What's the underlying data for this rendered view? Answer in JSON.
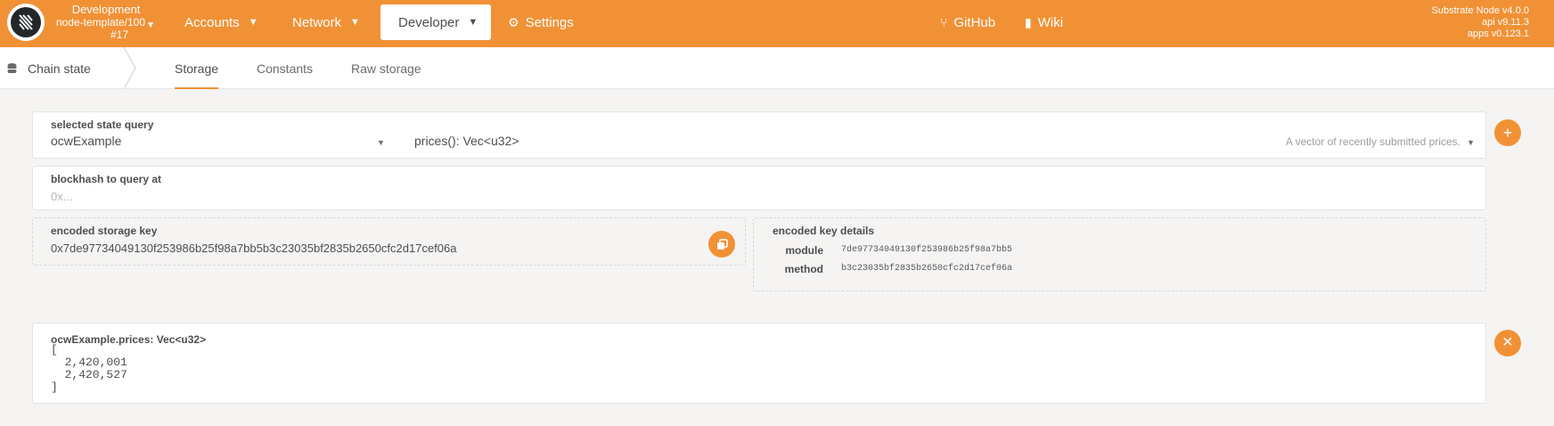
{
  "topbar": {
    "chain_name": "Development",
    "node": "node-template/100",
    "block": "#17",
    "menu": [
      {
        "label": "Accounts"
      },
      {
        "label": "Network"
      },
      {
        "label": "Developer"
      },
      {
        "label": "Settings"
      }
    ],
    "links": [
      {
        "label": "GitHub"
      },
      {
        "label": "Wiki"
      }
    ],
    "version": {
      "node": "Substrate Node v4.0.0",
      "api": "api v9.11.3",
      "apps": "apps v0.123.1"
    }
  },
  "subnav": {
    "section": "Chain state",
    "tabs": [
      "Storage",
      "Constants",
      "Raw storage"
    ]
  },
  "query": {
    "selected_label": "selected state query",
    "module_value": "ocwExample",
    "method_value": "prices(): Vec<u32>",
    "method_hint": "A vector of recently submitted prices."
  },
  "blockhash": {
    "label": "blockhash to query at",
    "placeholder": "0x..."
  },
  "encoded_key": {
    "label": "encoded storage key",
    "value": "0x7de97734049130f253986b25f98a7bb5b3c23035bf2835b2650cfc2d17cef06a"
  },
  "key_details": {
    "label": "encoded key details",
    "module_label": "module",
    "module_value": "7de97734049130f253986b25f98a7bb5",
    "method_label": "method",
    "method_value": "b3c23035bf2835b2650cfc2d17cef06a"
  },
  "result": {
    "title": "ocwExample.prices: Vec<u32>",
    "lines": [
      "[",
      "  2,420,001",
      "  2,420,527",
      "]"
    ]
  },
  "colors": {
    "accent": "#f19135",
    "background": "#f5f4f3"
  },
  "icons": {
    "add": "plus-icon",
    "remove": "close-icon",
    "copy": "copy-icon",
    "settings": "gear-icon",
    "github": "git-branch-icon",
    "wiki": "book-icon",
    "chain_state": "database-icon"
  }
}
